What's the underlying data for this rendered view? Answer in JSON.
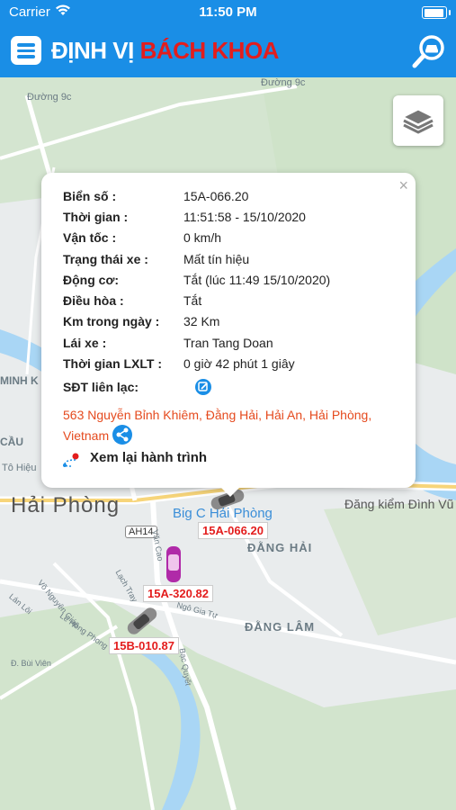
{
  "status_bar": {
    "carrier": "Carrier",
    "time": "11:50 PM",
    "battery_level": 0.95
  },
  "header": {
    "title_part1": "ĐỊNH VỊ ",
    "title_part2": "BÁCH KHOA"
  },
  "map": {
    "labels": [
      {
        "text": "Đường 9c"
      },
      {
        "text": "Đường 9c"
      },
      {
        "text": "MINH K"
      },
      {
        "text": "CẦU"
      },
      {
        "text": "Tô Hiệu"
      },
      {
        "text": "Hải Phòng"
      },
      {
        "text": "AH14"
      },
      {
        "text": "Big C Hải Phòng"
      },
      {
        "text": "Đăng kiểm Đình Vũ"
      },
      {
        "text": "ĐẰNG HẢI"
      },
      {
        "text": "ĐẰNG LÂM"
      },
      {
        "text": "Văn Cao"
      },
      {
        "text": "Lạch Tray"
      },
      {
        "text": "Ngô Gia Tự"
      },
      {
        "text": "Võ Nguyên Giáp"
      },
      {
        "text": "Lê Hồng Phong"
      },
      {
        "text": "Đ. Bùi Viên"
      },
      {
        "text": "Lán Lôi"
      },
      {
        "text": "Bạc Quyết"
      }
    ],
    "vehicles": [
      {
        "plate": "15A-066.20",
        "color": "#8a8a8a"
      },
      {
        "plate": "15A-320.82",
        "color": "#b02aa8"
      },
      {
        "plate": "15B-010.87",
        "color": "#8a8a8a"
      }
    ]
  },
  "popup": {
    "rows": [
      {
        "label": "Biển số :",
        "value": "15A-066.20"
      },
      {
        "label": "Thời gian :",
        "value": "11:51:58 - 15/10/2020"
      },
      {
        "label": "Vận tốc :",
        "value": "0 km/h"
      },
      {
        "label": "Trạng thái xe :",
        "value": "Mất tín hiệu"
      },
      {
        "label": "Động cơ:",
        "value": "Tắt (lúc 11:49 15/10/2020)"
      },
      {
        "label": "Điều hòa :",
        "value": "Tắt"
      },
      {
        "label": "Km trong ngày :",
        "value": "32 Km"
      },
      {
        "label": "Lái xe :",
        "value": "Tran Tang Doan"
      },
      {
        "label": "Thời gian LXLT :",
        "value": "0 giờ 42 phút 1 giây"
      },
      {
        "label": "SĐT liên lạc:",
        "value": ""
      }
    ],
    "address": "563 Nguyễn Bỉnh Khiêm, Đằng Hải, Hải An, Hải Phòng, Vietnam",
    "replay_label": "Xem lại hành trình",
    "close_glyph": "×"
  },
  "colors": {
    "brand": "#1a8ee6",
    "accent_red": "#e31d1d",
    "address": "#e54a1e"
  }
}
